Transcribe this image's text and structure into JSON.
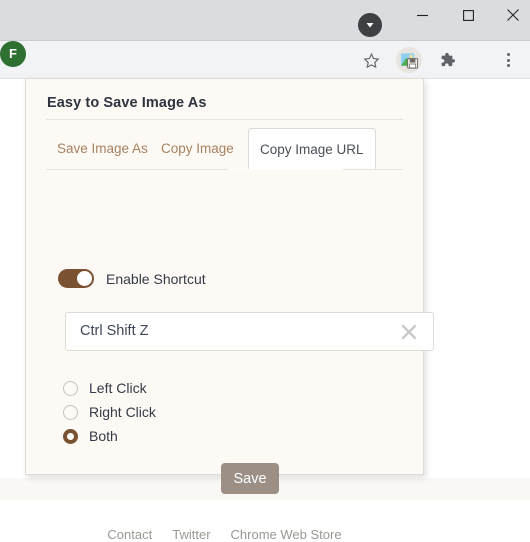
{
  "window": {
    "titlebar": {
      "tabstrip_chevron_icon": "chevron-down-circle-icon",
      "minimize_icon": "minimize-icon",
      "maximize_icon": "maximize-icon",
      "close_icon": "close-icon"
    },
    "toolbar": {
      "bookmark_icon": "star-icon",
      "extension_icon": "save-image-extension-icon",
      "extensions_puzzle_icon": "puzzle-piece-icon",
      "profile_initial": "F",
      "profile_color": "#2d7031",
      "menu_icon": "three-dots-vertical-icon"
    }
  },
  "popup": {
    "title": "Easy to Save Image As",
    "tabs": [
      {
        "label": "Save Image As",
        "active": false
      },
      {
        "label": "Copy Image",
        "active": false
      },
      {
        "label": "Copy Image URL",
        "active": true
      }
    ],
    "toggle": {
      "label": "Enable Shortcut",
      "enabled": true,
      "on_color": "#7a5232"
    },
    "shortcut": {
      "value": "Ctrl Shift Z",
      "placeholder": "Shortcut",
      "clear_icon": "close-x-icon"
    },
    "click_options": [
      {
        "label": "Left Click",
        "selected": false
      },
      {
        "label": "Right Click",
        "selected": false
      },
      {
        "label": "Both",
        "selected": true
      }
    ],
    "save_label": "Save",
    "save_color": "#9c9086",
    "accent_color": "#7a5232",
    "tab_inactive_color": "#a8815f",
    "footer_links": [
      "Contact",
      "Twitter",
      "Chrome Web Store"
    ]
  }
}
